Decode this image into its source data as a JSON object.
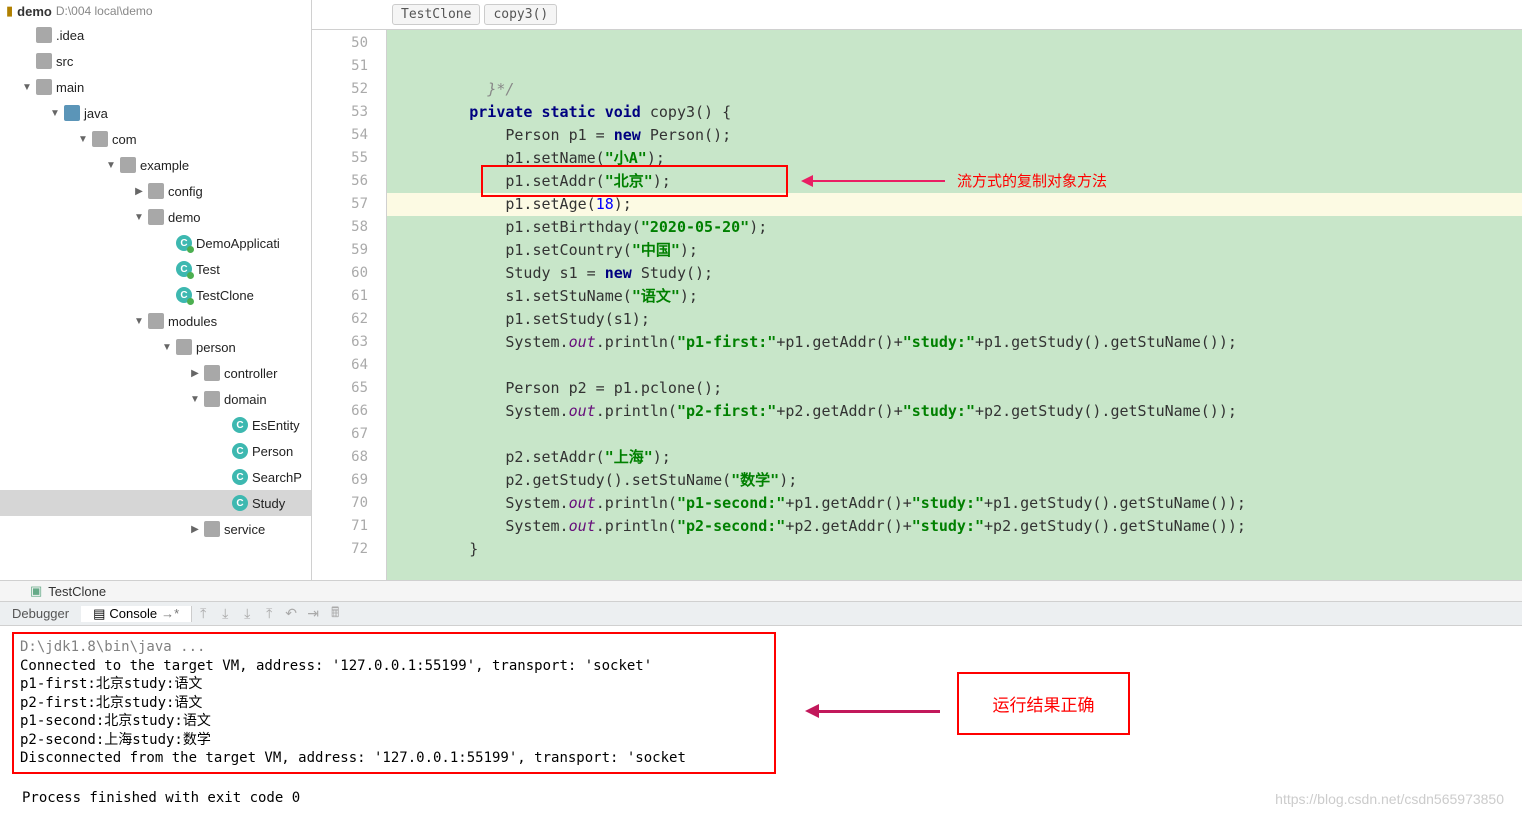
{
  "treeHeader": {
    "title": "demo",
    "sub": "D:\\004 local\\demo"
  },
  "tree": [
    {
      "indent": 0,
      "tri": "",
      "icon": "folder",
      "label": ".idea"
    },
    {
      "indent": 0,
      "tri": "",
      "icon": "folder",
      "label": "src"
    },
    {
      "indent": 0,
      "tri": "▼",
      "icon": "folder",
      "label": "main"
    },
    {
      "indent": 1,
      "tri": "▼",
      "icon": "folder-blue",
      "label": "java"
    },
    {
      "indent": 2,
      "tri": "▼",
      "icon": "folder",
      "label": "com"
    },
    {
      "indent": 3,
      "tri": "▼",
      "icon": "folder",
      "label": "example"
    },
    {
      "indent": 4,
      "tri": "▶",
      "icon": "folder",
      "label": "config"
    },
    {
      "indent": 4,
      "tri": "▼",
      "icon": "folder",
      "label": "demo"
    },
    {
      "indent": 5,
      "tri": "",
      "icon": "class-run",
      "label": "DemoApplicati"
    },
    {
      "indent": 5,
      "tri": "",
      "icon": "class-run",
      "label": "Test"
    },
    {
      "indent": 5,
      "tri": "",
      "icon": "class-run",
      "label": "TestClone"
    },
    {
      "indent": 4,
      "tri": "▼",
      "icon": "folder",
      "label": "modules"
    },
    {
      "indent": 5,
      "tri": "▼",
      "icon": "folder",
      "label": "person"
    },
    {
      "indent": 6,
      "tri": "▶",
      "icon": "folder",
      "label": "controller"
    },
    {
      "indent": 6,
      "tri": "▼",
      "icon": "folder",
      "label": "domain"
    },
    {
      "indent": 7,
      "tri": "",
      "icon": "class",
      "label": "EsEntity"
    },
    {
      "indent": 7,
      "tri": "",
      "icon": "class",
      "label": "Person"
    },
    {
      "indent": 7,
      "tri": "",
      "icon": "class",
      "label": "SearchP"
    },
    {
      "indent": 7,
      "tri": "",
      "icon": "class",
      "label": "Study",
      "selected": true
    },
    {
      "indent": 6,
      "tri": "▶",
      "icon": "folder",
      "label": "service"
    }
  ],
  "breadcrumb": [
    "TestClone",
    "copy3()"
  ],
  "lines": {
    "start": 50,
    "end": 72,
    "current": 55
  },
  "annotations": {
    "codeNote": "流方式的复制对象方法",
    "resultNote": "运行结果正确"
  },
  "toolStrip": {
    "label": "TestClone"
  },
  "tabBar": {
    "debugger": "Debugger",
    "console": "Console"
  },
  "console": {
    "text": "D:\\jdk1.8\\bin\\java ...\nConnected to the target VM, address: '127.0.0.1:55199', transport: 'socket'\np1-first:北京study:语文\np2-first:北京study:语文\np1-second:北京study:语文\np2-second:上海study:数学\nDisconnected from the target VM, address: '127.0.0.1:55199', transport: 'socket",
    "exit": "Process finished with exit code 0"
  },
  "watermark": "https://blog.csdn.net/csdn565973850"
}
